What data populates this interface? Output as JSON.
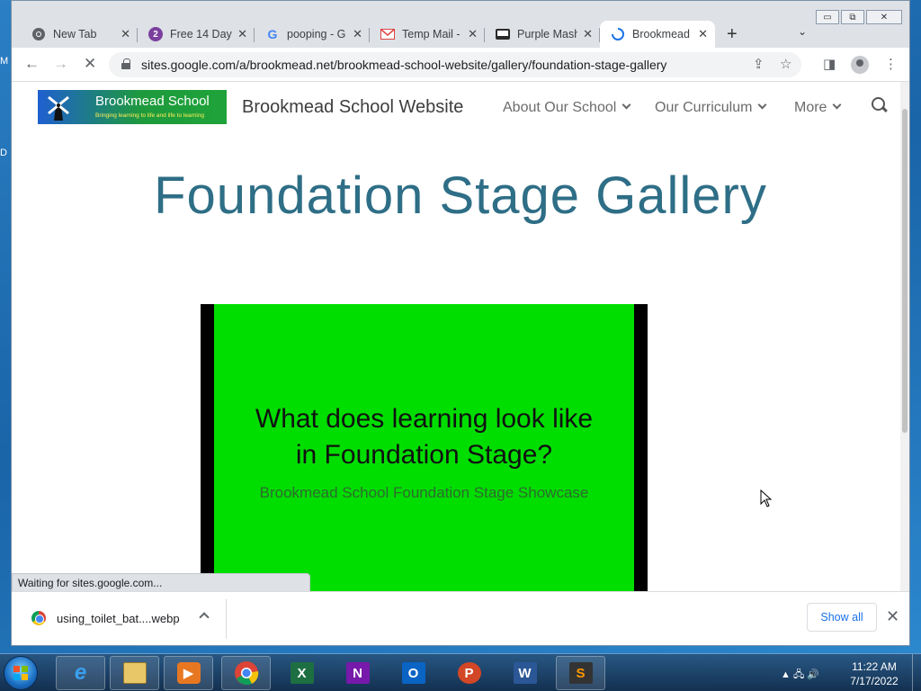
{
  "desktop": {
    "edge_letters": [
      "M",
      "D"
    ]
  },
  "window_controls": {
    "minimize": "▭",
    "restore": "⧉",
    "close": "✕"
  },
  "tabs": [
    {
      "title": "New Tab",
      "icon": "chrome-icon"
    },
    {
      "title": "Free 14 Day",
      "icon": "number-2-icon",
      "badge": "2"
    },
    {
      "title": "pooping - G",
      "icon": "google-icon",
      "badge": "G"
    },
    {
      "title": "Temp Mail -",
      "icon": "mail-icon"
    },
    {
      "title": "Purple Mash",
      "icon": "purple-mash-icon"
    },
    {
      "title": "Brookmead",
      "icon": "loading-spinner-icon",
      "active": true
    }
  ],
  "toolbar": {
    "back": "←",
    "forward": "→",
    "stop": "✕",
    "url": "sites.google.com/a/brookmead.net/brookmead-school-website/gallery/foundation-stage-gallery",
    "share": "⇪",
    "bookmark": "☆",
    "side_panel": "◨",
    "menu": "⋮",
    "new_tab": "+",
    "tab_search": "⌄"
  },
  "site": {
    "logo_name": "Brookmead School",
    "logo_tagline": "Bringing learning to life and life to learning",
    "title": "Brookmead School Website",
    "nav": [
      "About Our School",
      "Our Curriculum",
      "More"
    ]
  },
  "page": {
    "heading": "Foundation Stage Gallery",
    "video_heading_line1": "What does learning look like",
    "video_heading_line2": "in Foundation Stage?",
    "video_subtitle": "Brookmead School Foundation Stage Showcase"
  },
  "status": {
    "text": "Waiting for sites.google.com..."
  },
  "download": {
    "filename": "using_toilet_bat....webp",
    "show_all": "Show all",
    "close": "✕"
  },
  "taskbar": {
    "apps": [
      "internet-explorer",
      "file-explorer",
      "media-player",
      "chrome",
      "excel",
      "onenote",
      "outlook",
      "powerpoint",
      "word",
      "sublime-text"
    ],
    "tile_letters": {
      "excel": "X",
      "onenote": "N",
      "outlook": "O",
      "powerpoint": "P",
      "word": "W",
      "sublime": "S"
    },
    "tray_icons": "▲ 🖧 🔊",
    "time": "11:22 AM",
    "date": "7/17/2022"
  },
  "colors": {
    "heading": "#2e6e86",
    "video_bg": "#00de00",
    "link_blue": "#1a73e8"
  }
}
